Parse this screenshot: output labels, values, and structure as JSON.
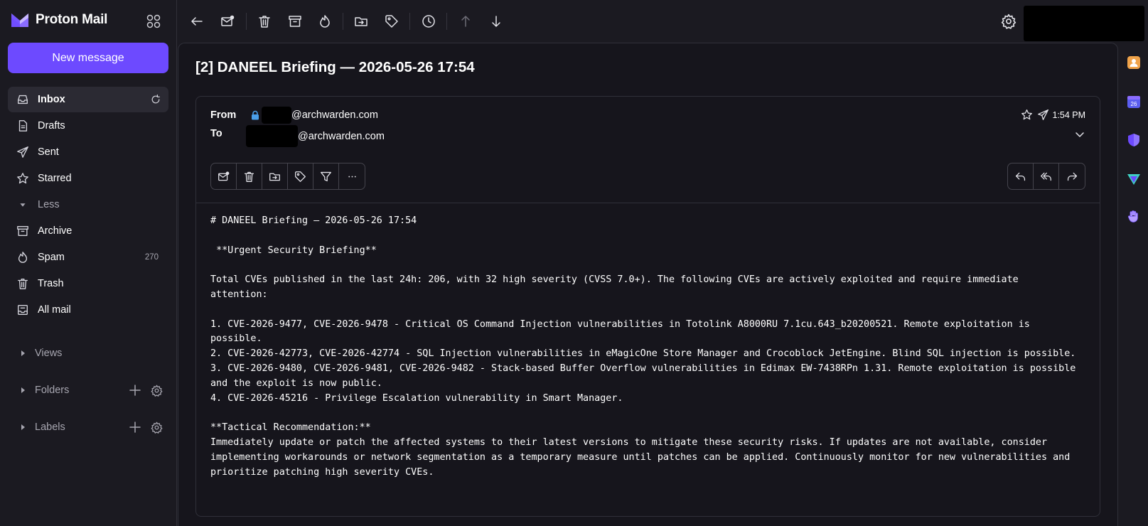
{
  "app": {
    "logo_text": "Proton Mail"
  },
  "sidebar": {
    "new_message": "New message",
    "items": [
      {
        "label": "Inbox",
        "icon": "inbox-icon",
        "active": true
      },
      {
        "label": "Drafts",
        "icon": "drafts-icon"
      },
      {
        "label": "Sent",
        "icon": "sent-icon"
      },
      {
        "label": "Starred",
        "icon": "star-icon"
      },
      {
        "label": "Less",
        "icon": "caret-down-icon"
      },
      {
        "label": "Archive",
        "icon": "archive-icon"
      },
      {
        "label": "Spam",
        "icon": "spam-icon",
        "count": "270"
      },
      {
        "label": "Trash",
        "icon": "trash-icon"
      },
      {
        "label": "All mail",
        "icon": "all-mail-icon"
      }
    ],
    "sections": {
      "views": "Views",
      "folders": "Folders",
      "labels": "Labels"
    }
  },
  "message": {
    "subject": "[2] DANEEL Briefing — 2026-05-26 17:54",
    "from_label": "From",
    "from_domain": "@archwarden.com",
    "to_label": "To",
    "to_domain": "@archwarden.com",
    "time": "1:54 PM",
    "body": "# DANEEL Briefing — 2026-05-26 17:54\n\n **Urgent Security Briefing**\n\nTotal CVEs published in the last 24h: 206, with 32 high severity (CVSS 7.0+). The following CVEs are actively exploited and require immediate attention:\n\n1. CVE-2026-9477, CVE-2026-9478 - Critical OS Command Injection vulnerabilities in Totolink A8000RU 7.1cu.643_b20200521. Remote exploitation is possible.\n2. CVE-2026-42773, CVE-2026-42774 - SQL Injection vulnerabilities in eMagicOne Store Manager and Crocoblock JetEngine. Blind SQL injection is possible.\n3. CVE-2026-9480, CVE-2026-9481, CVE-2026-9482 - Stack-based Buffer Overflow vulnerabilities in Edimax EW-7438RPn 1.31. Remote exploitation is possible and the exploit is now public.\n4. CVE-2026-45216 - Privilege Escalation vulnerability in Smart Manager.\n\n**Tactical Recommendation:**\nImmediately update or patch the affected systems to their latest versions to mitigate these security risks. If updates are not available, consider implementing workarounds or network segmentation as a temporary measure until patches can be applied. Continuously monitor for new vulnerabilities and prioritize patching high severity CVEs."
  },
  "colors": {
    "accent": "#6d4aff",
    "background": "#1b1a21",
    "pane": "#16151c",
    "border": "#303039"
  }
}
